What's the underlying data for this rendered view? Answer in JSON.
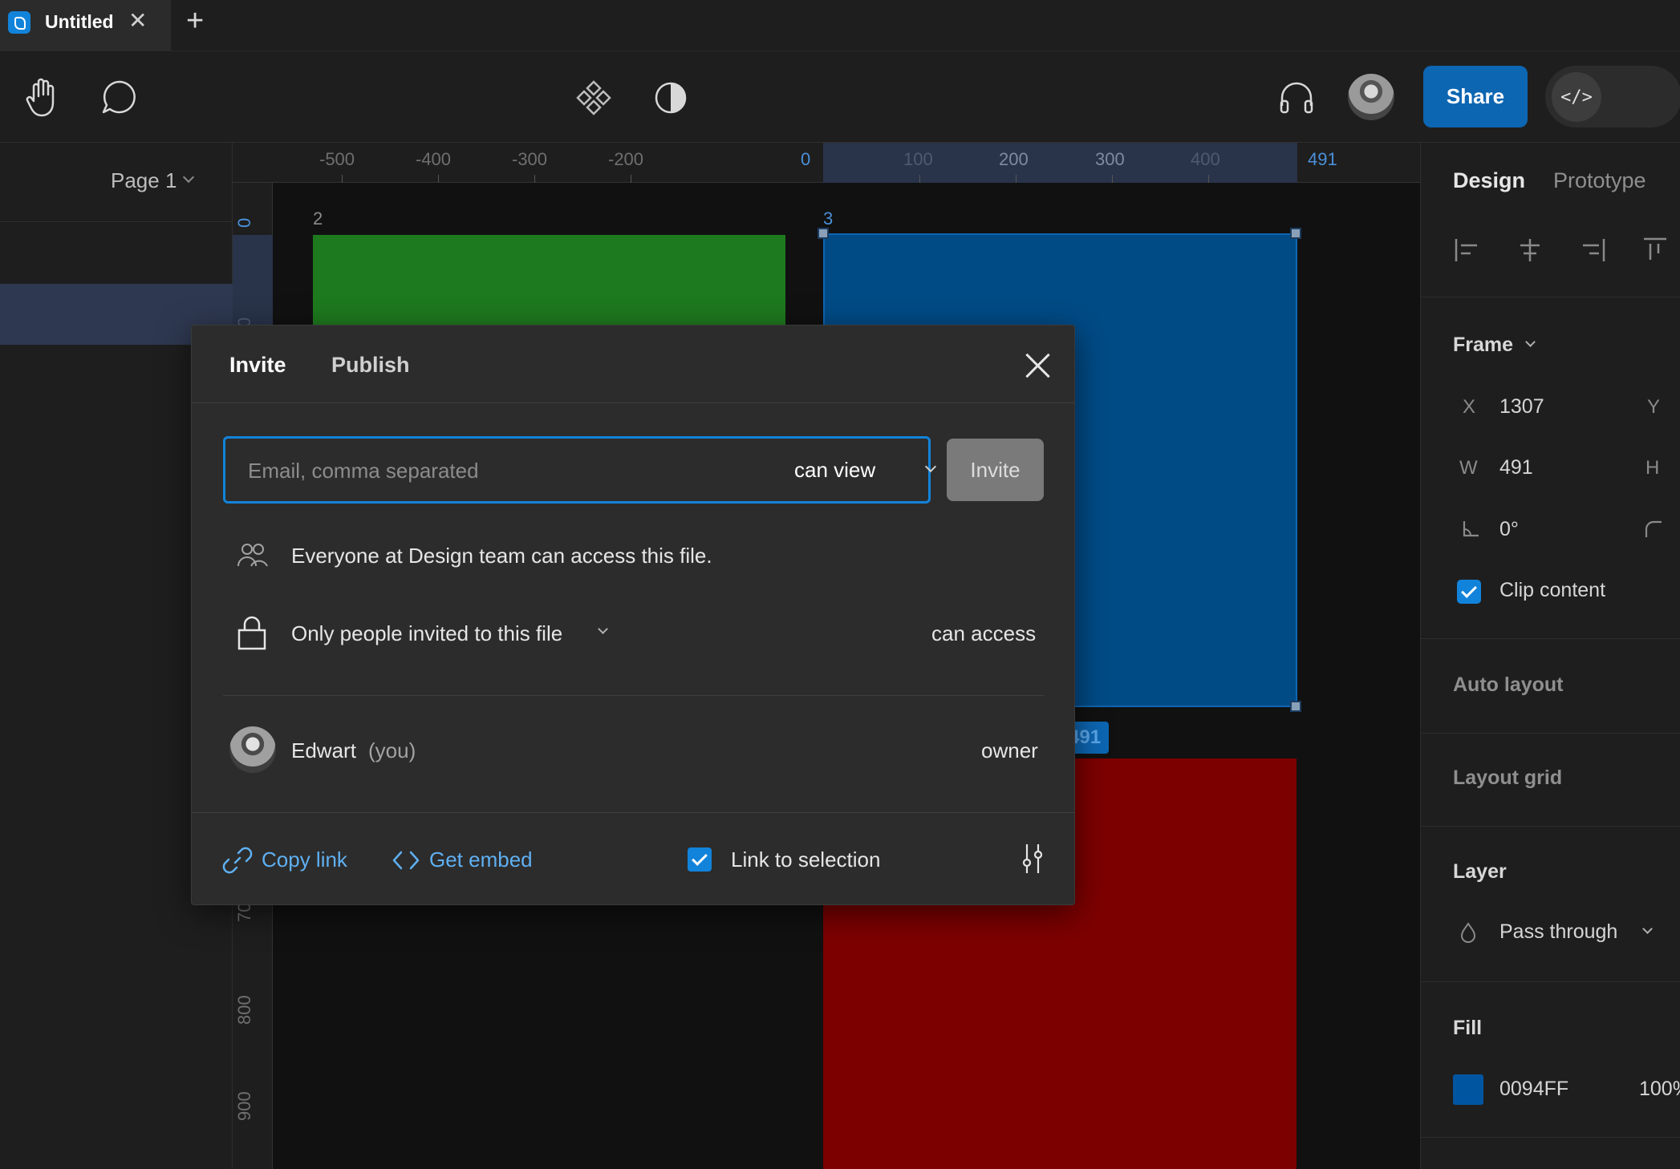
{
  "tab": {
    "title": "Untitled",
    "close": "✕",
    "add": "+"
  },
  "toolbar": {
    "share_label": "Share",
    "dev_mode_label": "</>"
  },
  "left_panel": {
    "page_label": "Page 1"
  },
  "rulers": {
    "top_labels": [
      "-500",
      "-400",
      "-300",
      "-200",
      "0",
      "100",
      "200",
      "300",
      "400",
      "491"
    ],
    "left_labels": [
      "0",
      "0",
      "70",
      "800",
      "900"
    ]
  },
  "canvas": {
    "frame_labels": [
      "2",
      "3"
    ],
    "selection_size_badge": "491",
    "colors": {
      "green": "#1e7a1e",
      "blue": "#004b86",
      "red": "#7d0000",
      "selection": "#0d66b2"
    }
  },
  "right_panel": {
    "tabs": [
      "Design",
      "Prototype"
    ],
    "frame": {
      "section": "Frame",
      "x_key": "X",
      "x_value": "1307",
      "y_key": "Y",
      "w_key": "W",
      "w_value": "491",
      "h_key": "H",
      "rotation_value": "0°",
      "clip_content_label": "Clip content",
      "clip_content_checked": true
    },
    "auto_layout": "Auto layout",
    "layout_grid": "Layout grid",
    "layer": {
      "section": "Layer",
      "blend_mode": "Pass through"
    },
    "fill": {
      "section": "Fill",
      "hex": "0094FF",
      "opacity": "100%"
    }
  },
  "modal": {
    "tabs": [
      "Invite",
      "Publish"
    ],
    "email_placeholder": "Email, comma separated",
    "permission_select": "can view",
    "invite_button": "Invite",
    "team_access_text": "Everyone at Design team can access this file.",
    "link_access_text": "Only people invited to this file",
    "link_access_permission": "can access",
    "member": {
      "name": "Edwart",
      "suffix": "(you)",
      "role": "owner"
    },
    "footer": {
      "copy_link": "Copy link",
      "get_embed": "Get embed",
      "link_to_selection": "Link to selection",
      "link_to_selection_checked": true
    },
    "accent_color": "#1283da"
  }
}
